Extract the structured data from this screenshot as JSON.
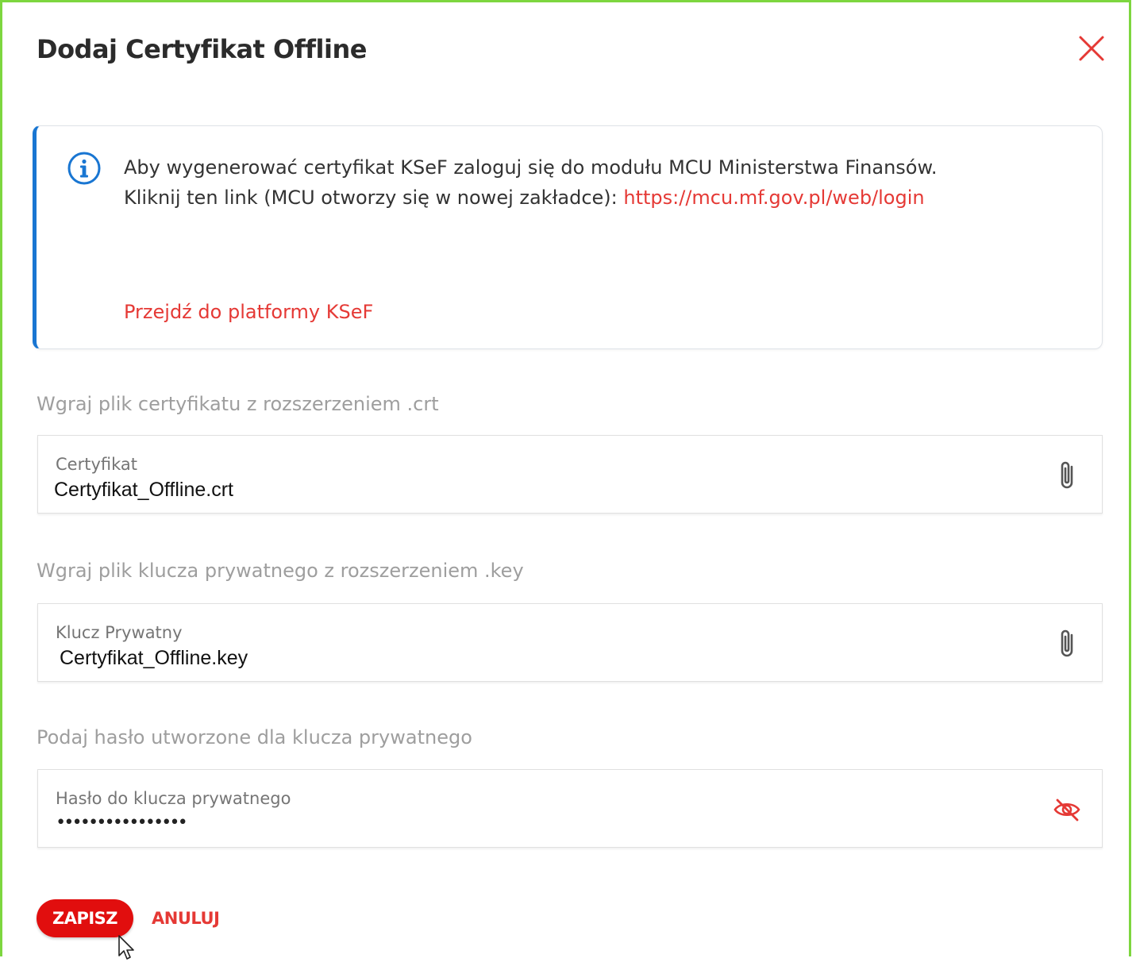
{
  "dialog": {
    "title": "Dodaj Certyfikat Offline",
    "close_icon": "close-icon"
  },
  "info": {
    "icon": "info-icon",
    "line1": "Aby wygenerować certyfikat KSeF zaloguj się do modułu MCU Ministerstwa Finansów.",
    "line2_prefix": "Kliknij ten link (MCU otworzy się w nowej zakładce): ",
    "mcu_link": "https://mcu.mf.gov.pl/web/login",
    "ksef_link": "Przejdź do platformy KSeF"
  },
  "certificate": {
    "section_label": "Wgraj plik certyfikatu z rozszerzeniem .crt",
    "field_label": "Certyfikat",
    "value": "Certyfikat_Offline.crt",
    "icon": "paperclip-icon"
  },
  "private_key": {
    "section_label": "Wgraj plik klucza prywatnego z rozszerzeniem .key",
    "field_label": "Klucz Prywatny",
    "value": "Certyfikat_Offline.key",
    "icon": "paperclip-icon"
  },
  "password": {
    "section_label": "Podaj hasło utworzone dla klucza prywatnego",
    "field_label": "Hasło do klucza prywatnego",
    "value": "••••••••••••••••",
    "icon": "eye-off-icon"
  },
  "actions": {
    "save_label": "ZAPISZ",
    "cancel_label": "ANULUJ"
  },
  "colors": {
    "accent": "#e10e0e",
    "link": "#e53935",
    "info_border": "#1976d2",
    "frame": "#7dd63f"
  }
}
